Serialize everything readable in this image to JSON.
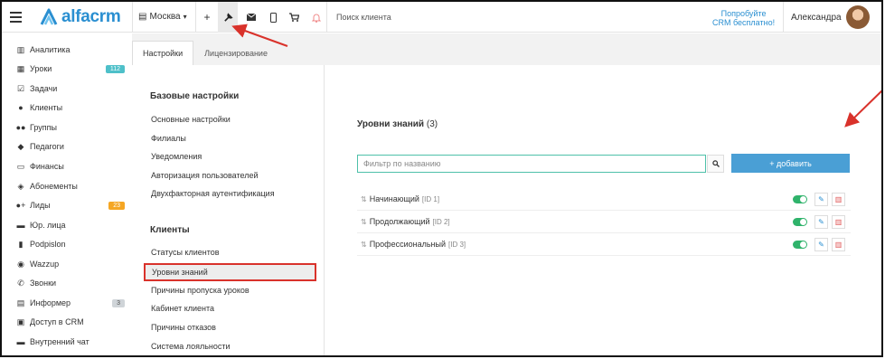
{
  "topbar": {
    "logo_text": "alfacrm",
    "city": "Москва",
    "search_placeholder": "Поиск клиента",
    "promo_line1": "Попробуйте",
    "promo_line2": "CRM бесплатно!",
    "user_name": "Александра",
    "icons": [
      "plus-icon",
      "wrench-icon",
      "mail-icon",
      "phone-icon",
      "cart-icon",
      "bell-icon"
    ]
  },
  "sidebar": {
    "items": [
      {
        "label": "Аналитика",
        "icon": "book-icon"
      },
      {
        "label": "Уроки",
        "icon": "calendar-icon",
        "badge": "112",
        "badge_color": "#4ec0c9"
      },
      {
        "label": "Задачи",
        "icon": "tasks-icon"
      },
      {
        "label": "Клиенты",
        "icon": "user-icon"
      },
      {
        "label": "Группы",
        "icon": "users-icon"
      },
      {
        "label": "Педагоги",
        "icon": "graduation-cap-icon"
      },
      {
        "label": "Финансы",
        "icon": "money-icon"
      },
      {
        "label": "Абонементы",
        "icon": "tag-icon"
      },
      {
        "label": "Лиды",
        "icon": "user-plus-icon",
        "badge": "23",
        "badge_color": "#f5a623"
      },
      {
        "label": "Юр. лица",
        "icon": "briefcase-icon"
      },
      {
        "label": "Podpislon",
        "icon": "file-icon"
      },
      {
        "label": "Wazzup",
        "icon": "whatsapp-icon"
      },
      {
        "label": "Звонки",
        "icon": "phone-icon"
      },
      {
        "label": "Информер",
        "icon": "list-icon",
        "badge": "3",
        "badge_color": "#cfd4d8"
      },
      {
        "label": "Доступ в CRM",
        "icon": "lock-icon"
      },
      {
        "label": "Внутренний чат",
        "icon": "chat-icon"
      }
    ]
  },
  "tabs": [
    {
      "label": "Настройки",
      "active": true
    },
    {
      "label": "Лицензирование",
      "active": false
    }
  ],
  "settings_menu": {
    "basic_heading": "Базовые настройки",
    "basic_items": [
      "Основные настройки",
      "Филиалы",
      "Уведомления",
      "Авторизация пользователей",
      "Двухфакторная аутентификация"
    ],
    "clients_heading": "Клиенты",
    "clients_items": [
      "Статусы клиентов",
      "Уровни знаний",
      "Причины пропуска уроков",
      "Кабинет клиента",
      "Причины отказов",
      "Система лояльности"
    ],
    "selected": "Уровни знаний"
  },
  "main": {
    "title": "Уровни знаний",
    "count": "(3)",
    "filter_placeholder": "Фильтр по названию",
    "add_label": "+ добавить",
    "levels": [
      {
        "name": "Начинающий",
        "id": "[ID 1]",
        "enabled": true
      },
      {
        "name": "Продолжающий",
        "id": "[ID 2]",
        "enabled": true
      },
      {
        "name": "Профессиональный",
        "id": "[ID 3]",
        "enabled": true
      }
    ]
  },
  "colors": {
    "brand": "#2a8fd1",
    "add_button": "#4a9fd5",
    "highlight_border": "#d9322b",
    "toggle_on": "#2fb36b"
  }
}
